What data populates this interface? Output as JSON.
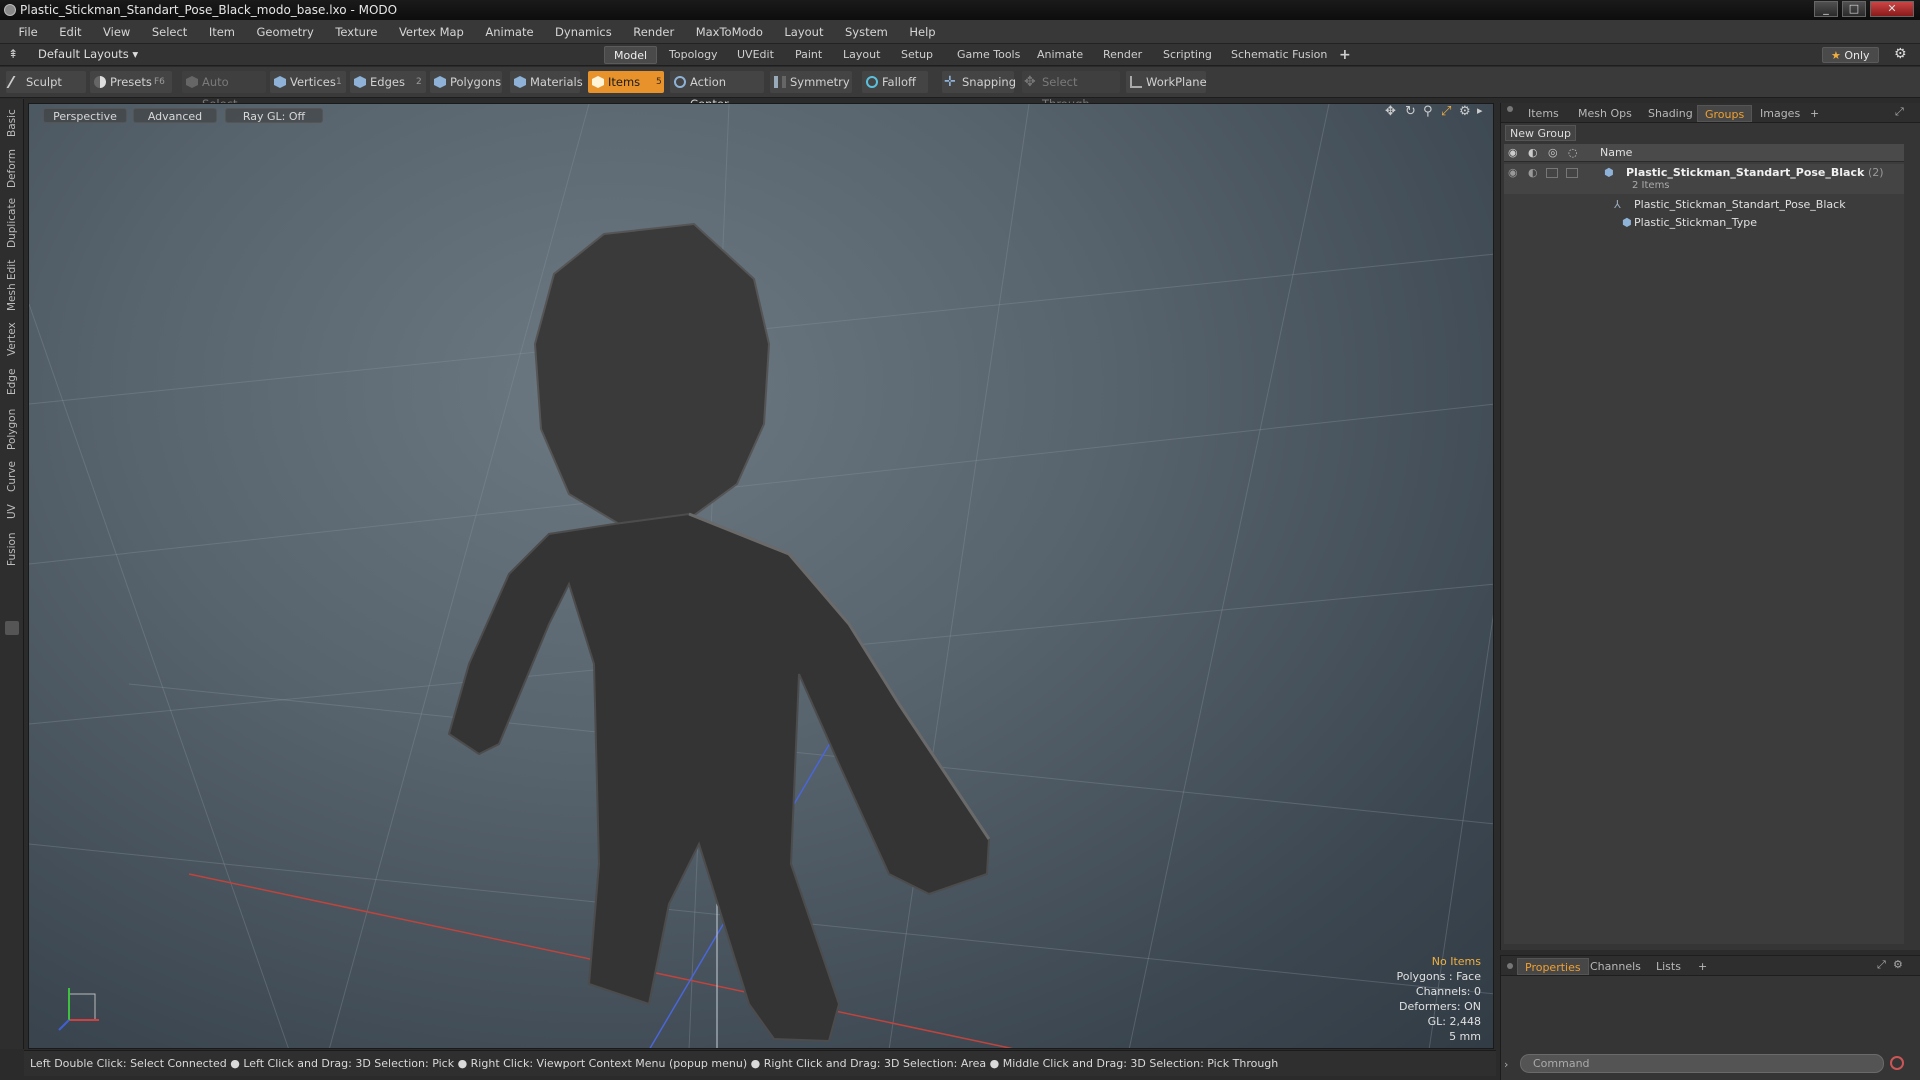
{
  "window": {
    "title": "Plastic_Stickman_Standart_Pose_Black_modo_base.lxo - MODO"
  },
  "menu": [
    "File",
    "Edit",
    "View",
    "Select",
    "Item",
    "Geometry",
    "Texture",
    "Vertex Map",
    "Animate",
    "Dynamics",
    "Render",
    "MaxToModo",
    "Layout",
    "System",
    "Help"
  ],
  "layout_bar": {
    "preset": "Default Layouts",
    "tabs": [
      "Model",
      "Topology",
      "UVEdit",
      "Paint",
      "Layout",
      "Setup",
      "Game Tools",
      "Animate",
      "Render",
      "Scripting",
      "Schematic Fusion"
    ],
    "active_tab": "Model",
    "add": "+",
    "only": "Only"
  },
  "toolbar": {
    "sculpt": "Sculpt",
    "presets": "Presets",
    "presets_key": "F6",
    "auto_select": "Auto Select",
    "vertices": "Vertices",
    "vertices_count": "1",
    "edges": "Edges",
    "edges_count": "2",
    "polygons": "Polygons",
    "materials": "Materials",
    "items": "Items",
    "items_count": "5",
    "action_center": "Action Center",
    "symmetry": "Symmetry",
    "falloff": "Falloff",
    "snapping": "Snapping",
    "select_through": "Select Through",
    "workplane": "WorkPlane"
  },
  "left_tabs": [
    "Basic",
    "Deform",
    "Duplicate",
    "Mesh Edit",
    "Vertex",
    "Edge",
    "Polygon",
    "Curve",
    "UV",
    "Fusion"
  ],
  "viewport": {
    "view": "Perspective",
    "shading": "Advanced",
    "raygl": "Ray GL: Off",
    "stats": {
      "items": "No Items",
      "polygons": "Polygons : Face",
      "channels": "Channels: 0",
      "deformers": "Deformers: ON",
      "gl": "GL: 2,448",
      "unit": "5 mm"
    }
  },
  "status_bar": "Left Double Click: Select Connected ● Left Click and Drag: 3D Selection: Pick ● Right Click: Viewport Context Menu (popup menu) ● Right Click and Drag: 3D Selection: Area ● Middle Click and Drag: 3D Selection: Pick Through",
  "right_panel": {
    "tabs": [
      "Items",
      "Mesh Ops",
      "Shading",
      "Groups",
      "Images"
    ],
    "active_tab": "Groups",
    "add": "+",
    "new_group": "New Group",
    "column_name": "Name",
    "group": {
      "name": "Plastic_Stickman_Standart_Pose_Black",
      "count": "(2)",
      "subtitle": "2 Items"
    },
    "children": [
      "Plastic_Stickman_Standart_Pose_Black",
      "Plastic_Stickman_Type"
    ]
  },
  "bottom_panel": {
    "tabs": [
      "Properties",
      "Channels",
      "Lists"
    ],
    "active_tab": "Properties",
    "add": "+",
    "command_placeholder": "Command"
  },
  "colors": {
    "accent": "#e8922c",
    "active_tab_text": "#f0a030"
  }
}
